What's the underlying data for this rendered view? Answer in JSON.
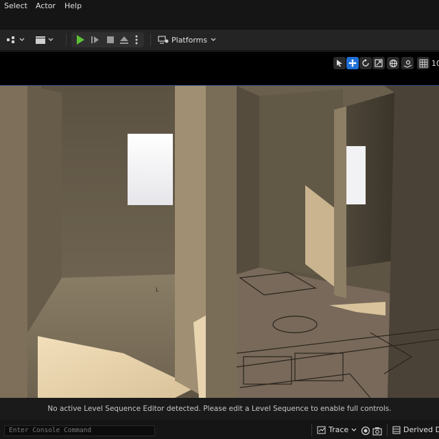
{
  "menu": {
    "items": [
      "Select",
      "Actor",
      "Help"
    ]
  },
  "toolbar": {
    "platforms_label": "Platforms"
  },
  "viewport": {
    "fov_label": "10",
    "notice": "No active Level Sequence Editor detected. Please edit a Level Sequence to enable full controls."
  },
  "status": {
    "console_placeholder": "Enter Console Command",
    "trace_label": "Trace",
    "ddc_label": "Derived Dat"
  },
  "colors": {
    "accent": "#1f6fd6",
    "play": "#5bc236",
    "background": "#151515"
  }
}
